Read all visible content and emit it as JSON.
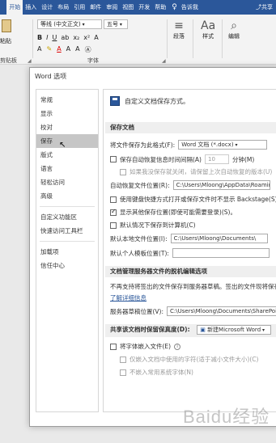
{
  "ribbon": {
    "tabs": [
      "开始",
      "插入",
      "设计",
      "布局",
      "引用",
      "邮件",
      "审阅",
      "视图",
      "开发",
      "帮助"
    ],
    "active_tab": 0,
    "tell_me": "告诉我",
    "share": "共享",
    "clipboard_label": "剪贴板",
    "paste_label": "粘贴",
    "font_name": "等线 (中文正文)",
    "font_size": "五号",
    "font_group_label": "字体",
    "paragraph_label": "段落",
    "styles_label": "样式",
    "editing_label": "编辑"
  },
  "dialog": {
    "title": "Word 选项",
    "nav": [
      {
        "label": "常规",
        "selected": false
      },
      {
        "label": "显示",
        "selected": false
      },
      {
        "label": "校对",
        "selected": false
      },
      {
        "label": "保存",
        "selected": true
      },
      {
        "label": "版式",
        "selected": false
      },
      {
        "label": "语言",
        "selected": false
      },
      {
        "label": "轻松访问",
        "selected": false
      },
      {
        "label": "高级",
        "selected": false
      },
      {
        "label": "自定义功能区",
        "selected": false
      },
      {
        "label": "快速访问工具栏",
        "selected": false
      },
      {
        "label": "加载项",
        "selected": false
      },
      {
        "label": "信任中心",
        "selected": false
      }
    ],
    "header": "自定义文档保存方式。",
    "save_docs": {
      "section": "保存文档",
      "format_label": "将文件保存为此格式(F):",
      "format_value": "Word 文档 (*.docx)",
      "autorecover_label": "保存自动恢复信息时间间隔(A)",
      "autorecover_minutes": "10",
      "minutes_unit": "分钟(M)",
      "keep_last_label": "如果我没保存就关闭，请保留上次自动恢复的版本(U)",
      "autorecover_location_label": "自动恢复文件位置(R):",
      "autorecover_location_value": "C:\\Users\\Mloong\\AppData\\Roaming",
      "no_backstage_label": "使用键盘快捷方式打开或保存文件时不显示 Backstage(S)",
      "show_more_locations_label": "显示其他保存位置(即使可能需要登录)(S)。",
      "default_to_computer_label": "默认情况下保存到计算机(C)",
      "default_local_label": "默认本地文件位置(I):",
      "default_local_value": "C:\\Users\\Mloong\\Documents\\",
      "default_template_label": "默认个人模板位置(T):",
      "default_template_value": ""
    },
    "offline_editing": {
      "section": "文档管理服务器文件的脱机编辑选项",
      "note": "不再支持将签出的文件保存到服务器草稿。签出的文件现将保存到 Office 文档缓存。",
      "learn_more": "了解详细信息",
      "drafts_label": "服务器草稿位置(V):",
      "drafts_value": "C:\\Users\\Mloong\\Documents\\SharePoint"
    },
    "fidelity": {
      "section": "共享该文档时保留保真度(D):",
      "doc_name": "新建Microsoft Word",
      "embed_fonts_label": "将字体嵌入文件(E)",
      "embed_used_only_label": "仅嵌入文档中使用的字符(适于减小文件大小)(C)",
      "no_common_fonts_label": "不嵌入常用系统字体(N)"
    }
  },
  "watermark": "Baidu经验"
}
